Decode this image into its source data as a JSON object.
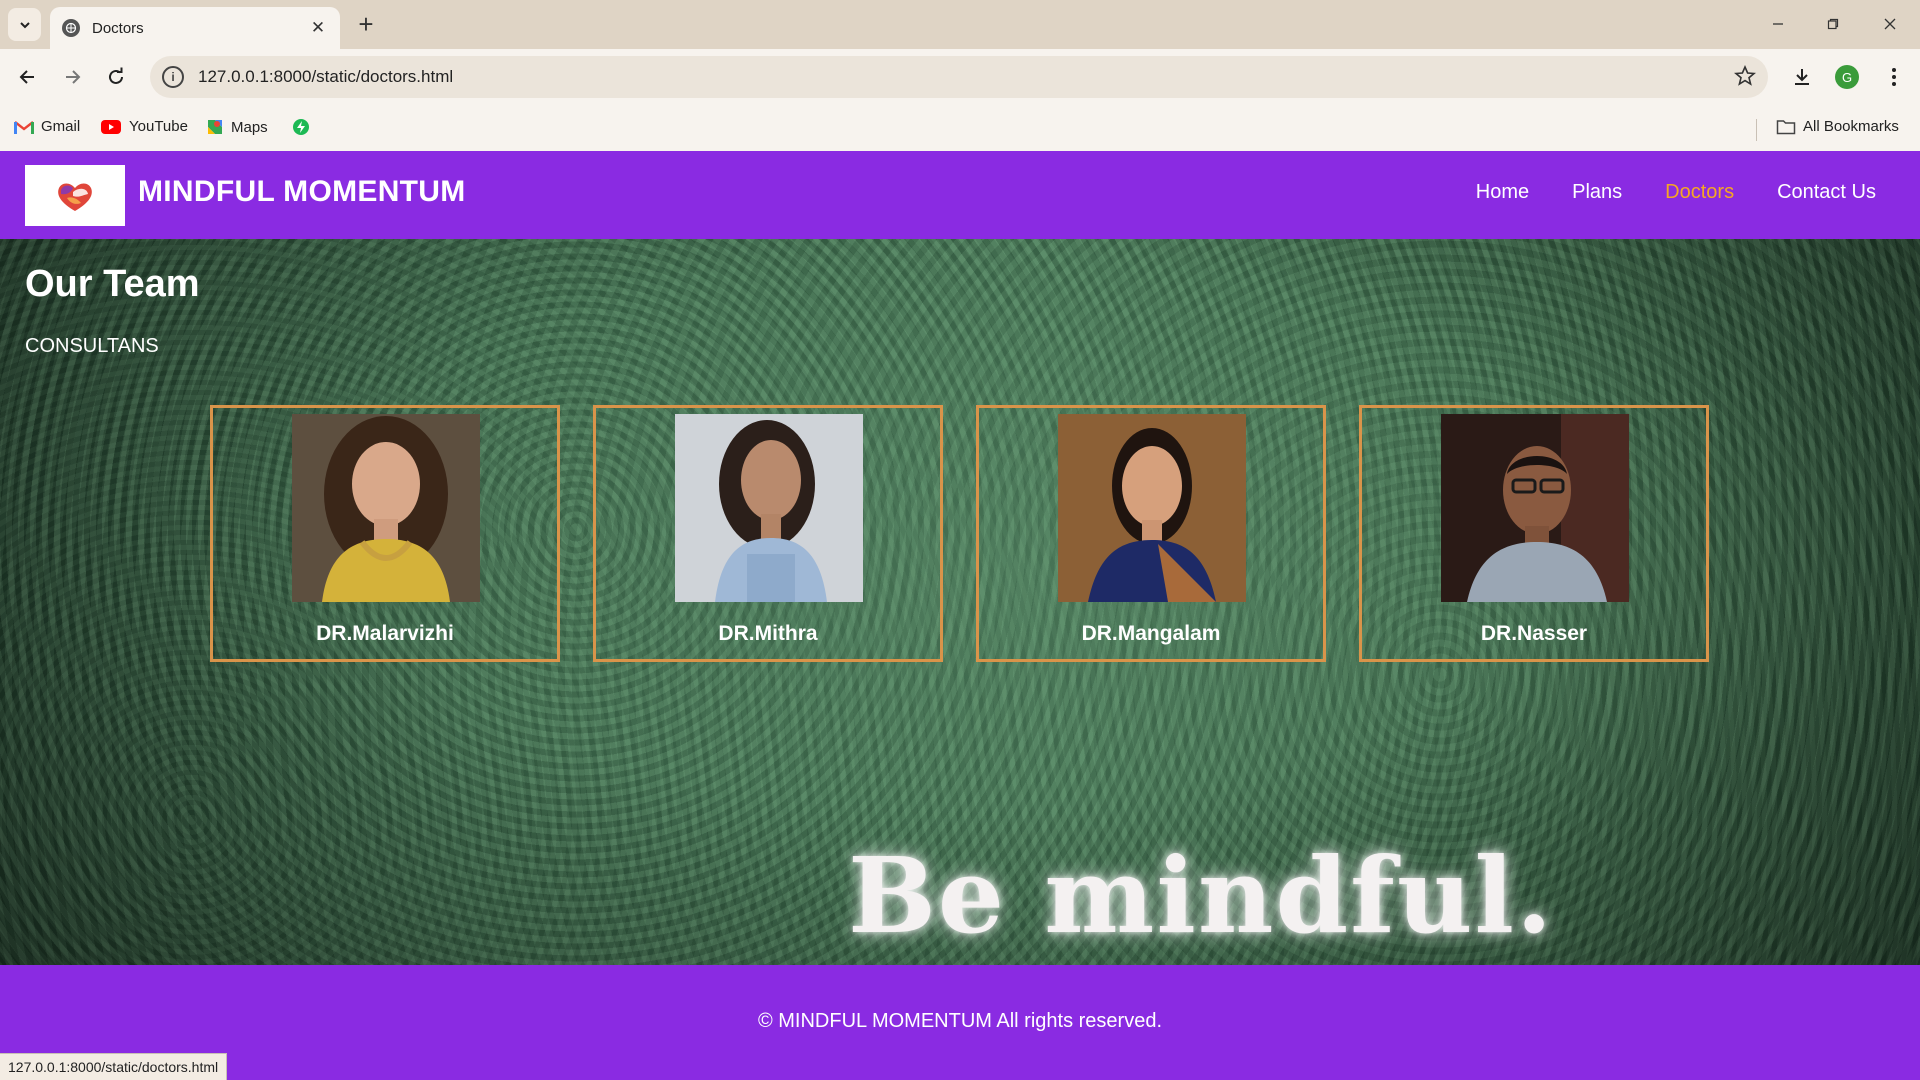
{
  "browser": {
    "tab_title": "Doctors",
    "url": "127.0.0.1:8000/static/doctors.html",
    "avatar_letter": "G",
    "bookmarks": [
      {
        "label": "Gmail",
        "icon": "gmail-icon"
      },
      {
        "label": "YouTube",
        "icon": "youtube-icon"
      },
      {
        "label": "Maps",
        "icon": "maps-icon"
      },
      {
        "label": "",
        "icon": "extension-bolt-icon"
      }
    ],
    "all_bookmarks_label": "All Bookmarks",
    "status_url": "127.0.0.1:8000/static/doctors.html"
  },
  "site": {
    "brand": "MINDFUL MOMENTUM",
    "nav": [
      {
        "label": "Home",
        "active": false
      },
      {
        "label": "Plans",
        "active": false
      },
      {
        "label": "Doctors",
        "active": true
      },
      {
        "label": "Contact Us",
        "active": false
      }
    ],
    "accent_color": "#8a2be2",
    "active_nav_color": "#f6a623",
    "card_border_color": "#d9944a"
  },
  "team": {
    "title": "Our Team",
    "subtitle": "CONSULTANS",
    "doctors": [
      {
        "name": "DR.Malarvizhi"
      },
      {
        "name": "DR.Mithra"
      },
      {
        "name": "DR.Mangalam"
      },
      {
        "name": "DR.Nasser"
      }
    ]
  },
  "motto": "Be mindful.",
  "footer": {
    "copyright": "© MINDFUL MOMENTUM All rights reserved."
  }
}
